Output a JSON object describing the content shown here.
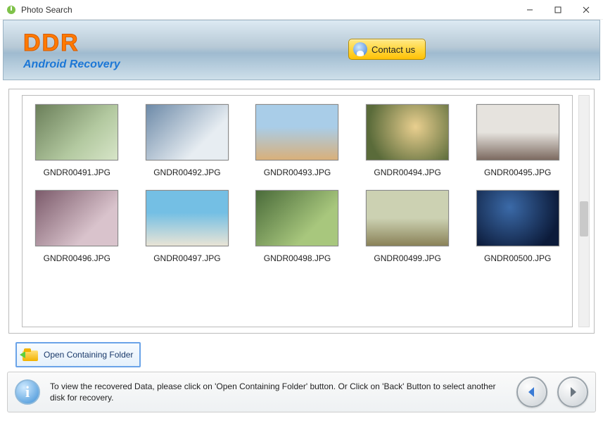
{
  "window": {
    "title": "Photo Search"
  },
  "header": {
    "brand": "DDR",
    "subtitle": "Android Recovery",
    "contact_label": "Contact us"
  },
  "files": [
    {
      "name": "GNDR00491.JPG"
    },
    {
      "name": "GNDR00492.JPG"
    },
    {
      "name": "GNDR00493.JPG"
    },
    {
      "name": "GNDR00494.JPG"
    },
    {
      "name": "GNDR00495.JPG"
    },
    {
      "name": "GNDR00496.JPG"
    },
    {
      "name": "GNDR00497.JPG"
    },
    {
      "name": "GNDR00498.JPG"
    },
    {
      "name": "GNDR00499.JPG"
    },
    {
      "name": "GNDR00500.JPG"
    }
  ],
  "actions": {
    "open_folder": "Open Containing Folder"
  },
  "footer": {
    "hint": "To view the recovered Data, please click on 'Open Containing Folder' button. Or Click on 'Back' Button to select another disk for recovery."
  }
}
